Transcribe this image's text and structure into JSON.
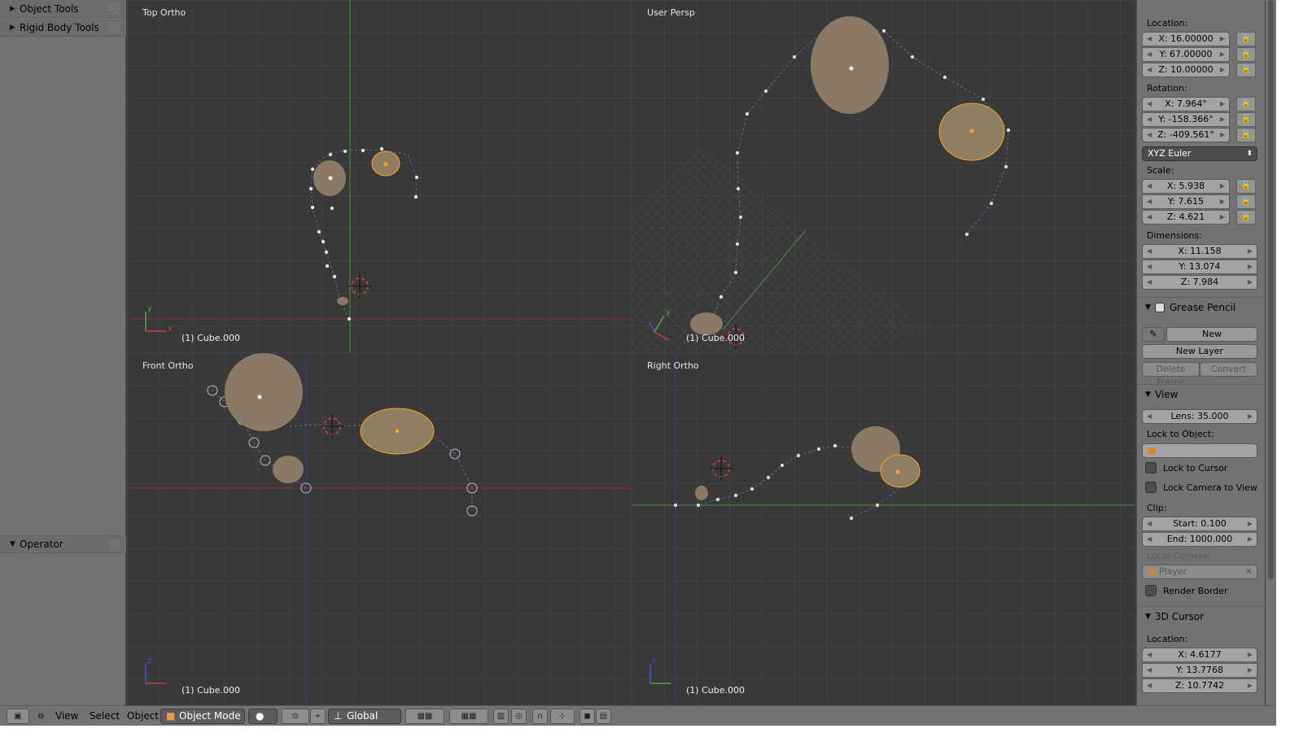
{
  "tool_shelf": {
    "object_tools": "Object Tools",
    "rigid_body_tools": "Rigid Body Tools",
    "operator": "Operator"
  },
  "viewports": {
    "top": {
      "label": "Top Ortho",
      "object": "(1) Cube.000"
    },
    "persp": {
      "label": "User Persp",
      "object": "(1) Cube.000"
    },
    "front": {
      "label": "Front Ortho",
      "object": "(1) Cube.000"
    },
    "right": {
      "label": "Right Ortho",
      "object": "(1) Cube.000"
    }
  },
  "properties": {
    "location_label": "Location:",
    "location": {
      "x": "X: 16.00000",
      "y": "Y: 67.00000",
      "z": "Z: 10.00000"
    },
    "rotation_label": "Rotation:",
    "rotation": {
      "x": "X: 7.964°",
      "y": "Y: -158.366°",
      "z": "Z: -409.561°"
    },
    "rotation_mode": "XYZ Euler",
    "scale_label": "Scale:",
    "scale": {
      "x": "X: 5.938",
      "y": "Y: 7.615",
      "z": "Z: 4.621"
    },
    "dimensions_label": "Dimensions:",
    "dimensions": {
      "x": "X: 11.158",
      "y": "Y: 13.074",
      "z": "Z: 7.984"
    },
    "grease_pencil": {
      "title": "Grease Pencil",
      "new": "New",
      "new_layer": "New Layer",
      "delete_frame": "Delete Frame",
      "convert": "Convert"
    },
    "view": {
      "title": "View",
      "lens": "Lens: 35.000",
      "lock_to_object": "Lock to Object:",
      "lock_to_cursor": "Lock to Cursor",
      "lock_camera_to_view": "Lock Camera to View",
      "clip_label": "Clip:",
      "clip_start": "Start: 0.100",
      "clip_end": "End: 1000.000",
      "local_camera_label": "Local Camera:",
      "local_camera": "Player",
      "render_border": "Render Border"
    },
    "cursor": {
      "title": "3D Cursor",
      "location_label": "Location:",
      "x": "X: 4.6177",
      "y": "Y: 13.7768",
      "z": "Z: 10.7742"
    }
  },
  "bottom_bar": {
    "view": "View",
    "select": "Select",
    "object": "Object",
    "mode": "Object Mode",
    "orientation": "Global"
  },
  "colors": {
    "accent_orange": "#f5a623",
    "rock": "#8a7a65"
  }
}
